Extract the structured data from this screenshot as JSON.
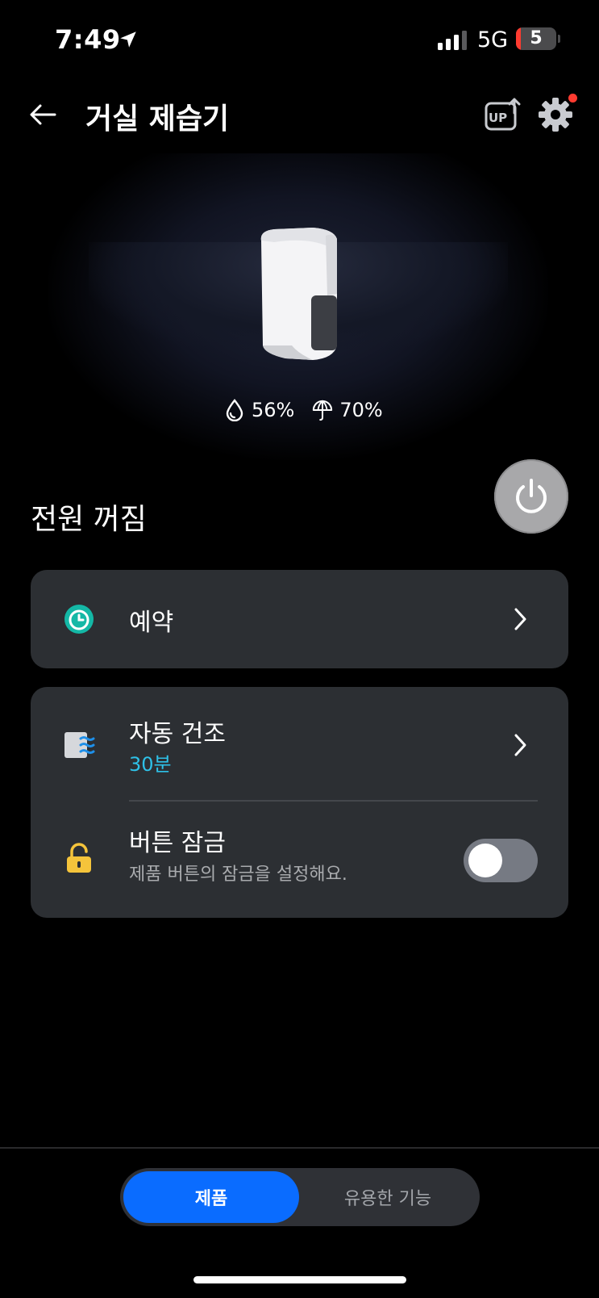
{
  "status_bar": {
    "time": "7:49",
    "network": "5G",
    "battery": "5"
  },
  "header": {
    "title": "거실 제습기"
  },
  "device": {
    "humidity": "56%",
    "target_humidity": "70%"
  },
  "power": {
    "label": "전원 꺼짐",
    "on": false
  },
  "schedule": {
    "label": "예약",
    "icon": "clock-icon"
  },
  "auto_dry": {
    "label": "자동 건조",
    "value": "30분",
    "icon": "auto-dry-icon"
  },
  "button_lock": {
    "label": "버튼 잠금",
    "description": "제품 버튼의 잠금을 설정해요.",
    "enabled": false,
    "icon": "lock-icon"
  },
  "tabs": [
    {
      "label": "제품",
      "active": true
    },
    {
      "label": "유용한 기능",
      "active": false
    }
  ],
  "colors": {
    "accent": "#0a6cff",
    "sub_value": "#2ec1e8",
    "clock_icon": "#14b8a6",
    "lock_icon": "#f5c43b",
    "notification": "#ff3b30"
  }
}
